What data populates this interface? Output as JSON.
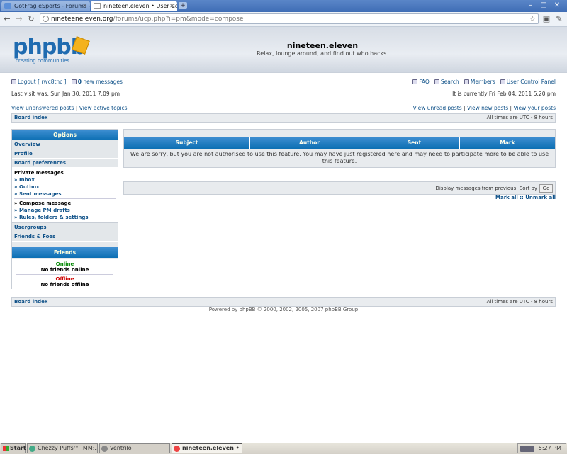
{
  "browser": {
    "tabs": [
      {
        "label": "GotFrag eSports - Forums - ...",
        "active": false
      },
      {
        "label": "nineteen.eleven • User Cont...",
        "active": true
      }
    ],
    "url_host": "nineteeneleven.org",
    "url_path": "/forums/ucp.php?i=pm&mode=compose"
  },
  "site": {
    "logo_text": "phpbb",
    "logo_tagline": "creating communities",
    "name": "nineteen.eleven",
    "description": "Relax, lounge around, and find out who hacks."
  },
  "userbar": {
    "logout": "Logout [ rwc8thc ]",
    "new_messages_count": "0",
    "new_messages_label": "new messages",
    "faq": "FAQ",
    "search": "Search",
    "members": "Members",
    "ucp": "User Control Panel",
    "last_visit": "Last visit was: Sun Jan 30, 2011 7:09 pm",
    "current_time": "It is currently Fri Feb 04, 2011 5:20 pm",
    "view_unanswered": "View unanswered posts",
    "view_active": "View active topics",
    "view_unread": "View unread posts",
    "view_new": "View new posts",
    "view_yours": "View your posts",
    "sep": "|"
  },
  "navstrip": {
    "board_index": "Board index",
    "timezone": "All times are UTC - 8 hours"
  },
  "sidebar": {
    "options_title": "Options",
    "overview": "Overview",
    "profile": "Profile",
    "board_prefs": "Board preferences",
    "pm_title": "Private messages",
    "pm_items": [
      "» Inbox",
      "» Outbox",
      "» Sent messages",
      "» Compose message",
      "» Manage PM drafts",
      "» Rules, folders & settings"
    ],
    "usergroups": "Usergroups",
    "friends_foes": "Friends & Foes",
    "friends_title": "Friends",
    "online": "Online",
    "no_online": "No friends online",
    "offline": "Offline",
    "no_offline": "No friends offline"
  },
  "table": {
    "headers": [
      "Subject",
      "Author",
      "Sent",
      "Mark"
    ],
    "message": "We are sorry, but you are not authorised to use this feature. You may have just registered here and may need to participate more to be able to use this feature."
  },
  "filter": {
    "label": "Display messages from previous:  Sort by",
    "go": "Go",
    "mark_all": "Mark all :: Unmark all"
  },
  "footer": {
    "powered": "Powered by phpBB © 2000, 2002, 2005, 2007 phpBB Group"
  },
  "taskbar": {
    "start": "Start",
    "tasks": [
      "Chezzy Puffs™ :MM:...",
      "Ventrilo",
      "nineteen.eleven • ..."
    ],
    "clock": "5:27 PM"
  },
  "colors": {
    "accent": "#105289",
    "header_blue": "#0c6fb3",
    "online": "#0a8a0a",
    "offline": "#cc0000"
  }
}
